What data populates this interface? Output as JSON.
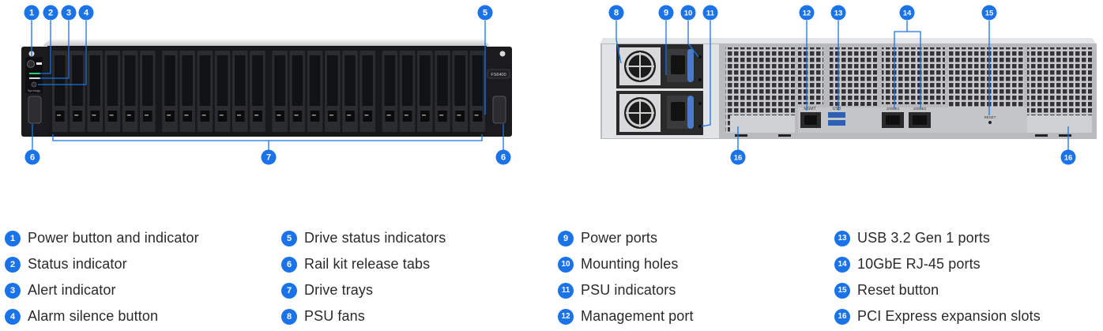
{
  "colors": {
    "badge": "#1a73e8",
    "chassis_dark": "#1b1b1d",
    "tray": "#2b2c2f",
    "tray_face": "#111214",
    "rear_panel": "#d4d5d7",
    "rear_frame": "#2a2a2a",
    "leader": "#1a73e8"
  },
  "front_panel": {
    "model_label": "FS6400",
    "brand_label": "Synology",
    "drive_count": 24,
    "drive_groups": 4
  },
  "rear_panel": {
    "mgmt_label": "MGMT",
    "lan1_label": "10GbE1",
    "lan2_label": "10GbE2",
    "reset_label": "RESET",
    "usb_label": "USB"
  },
  "callouts": {
    "front": [
      "1",
      "2",
      "3",
      "4",
      "5",
      "6",
      "7",
      "6"
    ],
    "rear": [
      "8",
      "9",
      "10",
      "11",
      "12",
      "13",
      "14",
      "15",
      "16",
      "16"
    ]
  },
  "legend": {
    "columns": [
      [
        {
          "num": "1",
          "label": "Power button and indicator"
        },
        {
          "num": "2",
          "label": "Status indicator"
        },
        {
          "num": "3",
          "label": "Alert indicator"
        },
        {
          "num": "4",
          "label": "Alarm silence button"
        }
      ],
      [
        {
          "num": "5",
          "label": "Drive status indicators"
        },
        {
          "num": "6",
          "label": "Rail kit release tabs"
        },
        {
          "num": "7",
          "label": "Drive trays"
        },
        {
          "num": "8",
          "label": "PSU fans"
        }
      ],
      [
        {
          "num": "9",
          "label": "Power ports"
        },
        {
          "num": "10",
          "label": "Mounting holes"
        },
        {
          "num": "11",
          "label": "PSU indicators"
        },
        {
          "num": "12",
          "label": "Management port"
        }
      ],
      [
        {
          "num": "13",
          "label": "USB 3.2 Gen 1 ports"
        },
        {
          "num": "14",
          "label": "10GbE RJ-45 ports"
        },
        {
          "num": "15",
          "label": "Reset button"
        },
        {
          "num": "16",
          "label": "PCI Express expansion slots"
        }
      ]
    ]
  }
}
